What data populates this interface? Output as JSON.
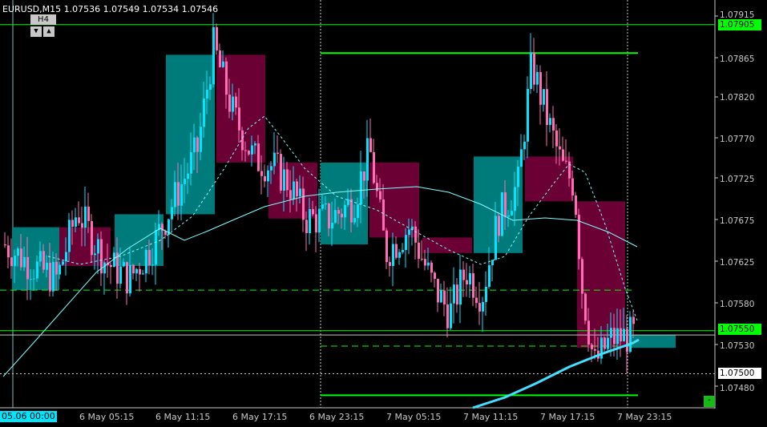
{
  "header": {
    "symbol": "EURUSD,M15",
    "ohlc": "1.07536 1.07549 1.07534 1.07546",
    "title": "EURUSD,M15  1.07536 1.07549 1.07534 1.07546"
  },
  "timeframe": {
    "label": "H4",
    "down_icon": "▼",
    "up_icon": "▲"
  },
  "price_axis": {
    "labels": [
      "1.07915",
      "1.07865",
      "1.07820",
      "1.07770",
      "1.07725",
      "1.07675",
      "1.07625",
      "1.07580",
      "1.07530",
      "1.07480"
    ],
    "badges": [
      {
        "text": "1.07905",
        "bg": "#00ff00",
        "fg": "#000000"
      },
      {
        "text": "1.07550",
        "bg": "#00ff00",
        "fg": "#000000"
      },
      {
        "text": "1.07500",
        "bg": "#ffffff",
        "fg": "#000000"
      }
    ]
  },
  "time_axis": {
    "badge": "05.06 00:00",
    "labels": [
      "6 May 05:15",
      "6 May 11:15",
      "6 May 17:15",
      "6 May 23:15",
      "7 May 05:15",
      "7 May 11:15",
      "7 May 17:15",
      "7 May 23:15"
    ]
  },
  "corner_button": "-",
  "colors": {
    "background": "#000000",
    "bull_candle": "#00e5ff",
    "bear_candle": "#ff6eb4",
    "bull_block": "#007b7b",
    "bear_block": "#6b0035",
    "level_line": "#00ff00",
    "ma_line": "#7fffff",
    "grid": "#c8c8c8"
  },
  "chart_data": {
    "type": "candlestick",
    "symbol": "EURUSD",
    "timeframe": "M15",
    "ylim": [
      1.0746,
      1.0794
    ],
    "horizontal_levels": [
      1.07905,
      1.07872,
      1.07597,
      1.0755,
      1.07545,
      1.07532,
      1.075,
      1.07475
    ],
    "h4_blocks": [
      {
        "open": 1.07597,
        "close": 1.0767,
        "dir": "up"
      },
      {
        "open": 1.0767,
        "close": 1.07625,
        "dir": "down"
      },
      {
        "open": 1.07625,
        "close": 1.07685,
        "dir": "up"
      },
      {
        "open": 1.07685,
        "close": 1.0787,
        "dir": "up"
      },
      {
        "open": 1.0787,
        "close": 1.07745,
        "dir": "down"
      },
      {
        "open": 1.07745,
        "close": 1.0768,
        "dir": "down"
      },
      {
        "open": 1.0765,
        "close": 1.07745,
        "dir": "up"
      },
      {
        "open": 1.07745,
        "close": 1.07658,
        "dir": "down"
      },
      {
        "open": 1.07658,
        "close": 1.0764,
        "dir": "down"
      },
      {
        "open": 1.0764,
        "close": 1.07752,
        "dir": "up"
      },
      {
        "open": 1.07752,
        "close": 1.077,
        "dir": "down"
      },
      {
        "open": 1.077,
        "close": 1.0753,
        "dir": "down"
      },
      {
        "open": 1.0753,
        "close": 1.07545,
        "dir": "up"
      }
    ],
    "last_price": 1.07546
  }
}
